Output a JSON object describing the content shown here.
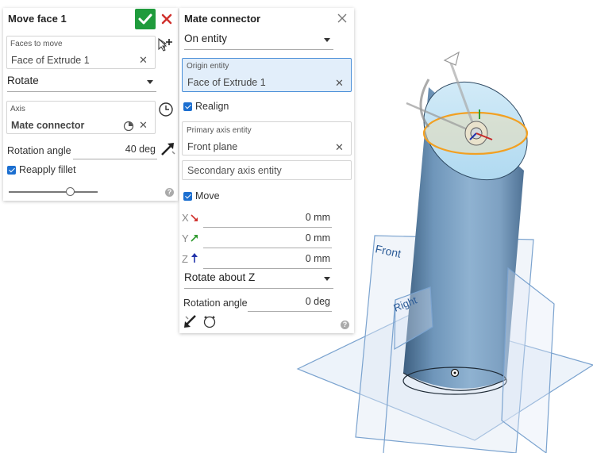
{
  "move_face": {
    "title": "Move face 1",
    "faces_to_move_label": "Faces to move",
    "faces_to_move_value": "Face of Extrude 1",
    "mode_value": "Rotate",
    "axis_label": "Axis",
    "axis_value": "Mate connector",
    "rotation_angle_label": "Rotation angle",
    "rotation_angle_value": "40 deg",
    "reapply_fillet_label": "Reapply fillet",
    "reapply_fillet_checked": true
  },
  "mate_connector": {
    "title": "Mate connector",
    "placement_value": "On entity",
    "origin_entity_label": "Origin entity",
    "origin_entity_value": "Face of Extrude 1",
    "realign_label": "Realign",
    "realign_checked": true,
    "primary_axis_label": "Primary axis entity",
    "primary_axis_value": "Front plane",
    "secondary_axis_placeholder": "Secondary axis entity",
    "move_label": "Move",
    "move_checked": true,
    "x_letter": "X",
    "x_value": "0 mm",
    "y_letter": "Y",
    "y_value": "0 mm",
    "z_letter": "Z",
    "z_value": "0 mm",
    "rotate_value": "Rotate about Z",
    "rotation_angle_label": "Rotation angle",
    "rotation_angle_value": "0 deg"
  },
  "scene": {
    "front_plane_label": "Front",
    "right_plane_label": "Right"
  },
  "colors": {
    "accept_green": "#1f9b3c",
    "cancel_red": "#d0312d",
    "active_field": "#e2eefa",
    "checkbox_blue": "#1c6fd0",
    "plane_stroke": "#7ba3cf",
    "selection_orange": "#f2a022"
  },
  "icons": [
    "checkmark-icon",
    "close-icon",
    "plus-icon",
    "clock-icon",
    "arrow-icon",
    "mate-connector-icon",
    "help-icon"
  ]
}
